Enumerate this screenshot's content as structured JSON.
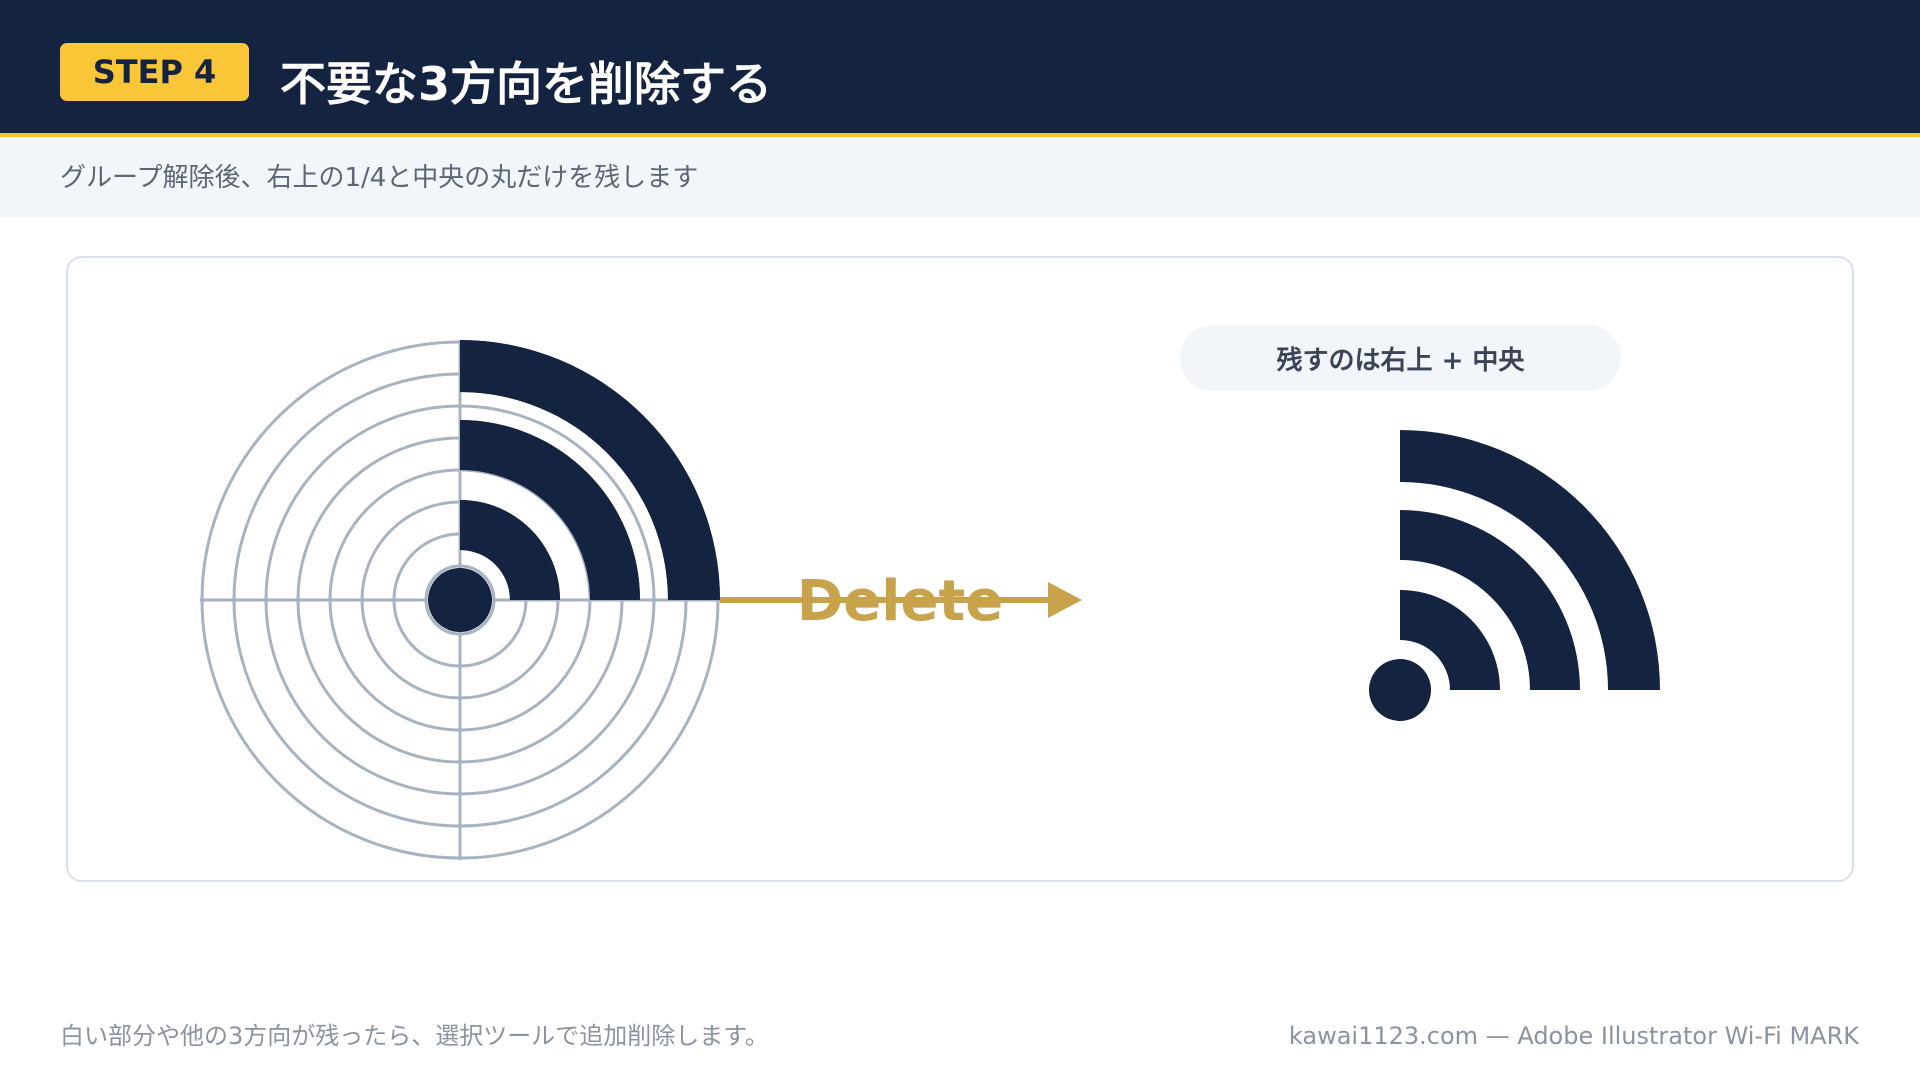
{
  "header": {
    "step": "STEP 4",
    "title": "不要な3方向を削除する"
  },
  "subtitle": "グループ解除後、右上の1/4と中央の丸だけを残します",
  "diagram": {
    "arrow_label": "Delete",
    "keep_label": "残すのは右上 + 中央"
  },
  "footer": {
    "note": "白い部分や他の3方向が残ったら、選択ツールで追加削除します。",
    "credit": "kawai1123.com — Adobe Illustrator Wi-Fi MARK"
  },
  "colors": {
    "navy": "#14233f",
    "accent_yellow": "#f9c638",
    "guide_gray": "#a8b3c2",
    "arrow_gold": "#c9a24c"
  }
}
